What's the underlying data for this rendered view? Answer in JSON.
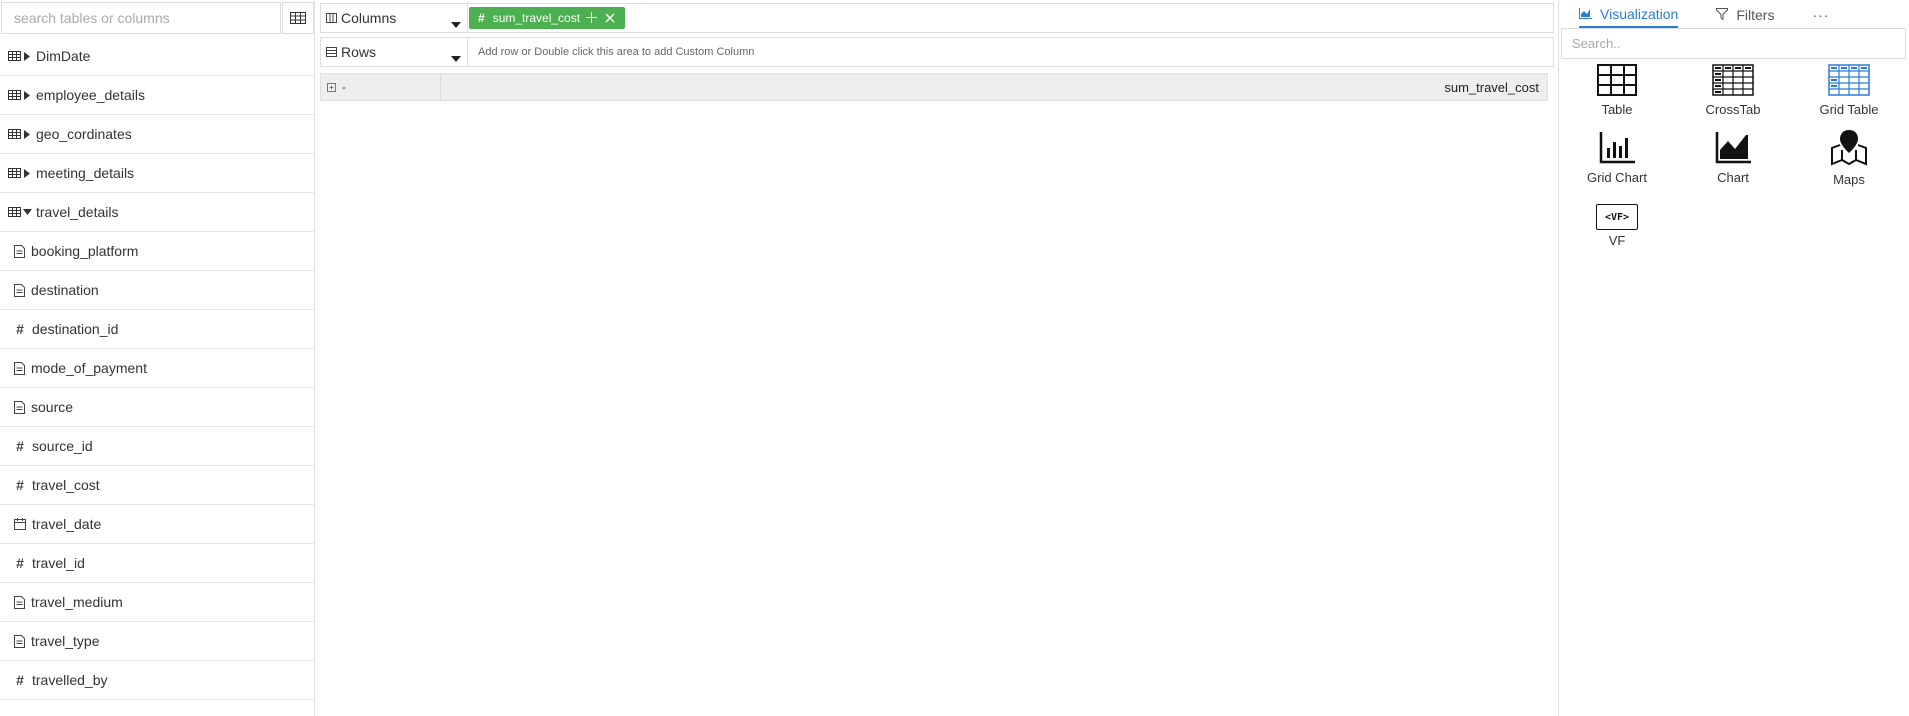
{
  "left_panel": {
    "search_placeholder": "search tables or columns",
    "tables": [
      {
        "label": "DimDate",
        "expanded": false
      },
      {
        "label": "employee_details",
        "expanded": false
      },
      {
        "label": "geo_cordinates",
        "expanded": false
      },
      {
        "label": "meeting_details",
        "expanded": false
      },
      {
        "label": "travel_details",
        "expanded": true
      }
    ],
    "columns": [
      {
        "label": "booking_platform",
        "type": "text"
      },
      {
        "label": "destination",
        "type": "text"
      },
      {
        "label": "destination_id",
        "type": "number"
      },
      {
        "label": "mode_of_payment",
        "type": "text"
      },
      {
        "label": "source",
        "type": "text"
      },
      {
        "label": "source_id",
        "type": "number"
      },
      {
        "label": "travel_cost",
        "type": "number"
      },
      {
        "label": "travel_date",
        "type": "date"
      },
      {
        "label": "travel_id",
        "type": "number"
      },
      {
        "label": "travel_medium",
        "type": "text"
      },
      {
        "label": "travel_type",
        "type": "text"
      },
      {
        "label": "travelled_by",
        "type": "number"
      }
    ]
  },
  "builder": {
    "columns_label": "Columns",
    "rows_label": "Rows",
    "column_pill": {
      "hash": "#",
      "label": "sum_travel_cost",
      "color": "#4caf50"
    },
    "rows_hint": "Add row or Double click this area to add Custom Column",
    "grid": {
      "first_header": "-",
      "column_header": "sum_travel_cost"
    }
  },
  "right_panel": {
    "tabs": [
      {
        "label": "Visualization",
        "active": true,
        "icon": "chart-area-icon"
      },
      {
        "label": "Filters",
        "active": false,
        "icon": "filter-icon"
      }
    ],
    "more": "···",
    "search_placeholder": "Search..",
    "visualizations": [
      {
        "label": "Table",
        "icon": "table-icon"
      },
      {
        "label": "CrossTab",
        "icon": "crosstab-icon"
      },
      {
        "label": "Grid Table",
        "icon": "grid-table-icon"
      },
      {
        "label": "Grid Chart",
        "icon": "grid-chart-icon"
      },
      {
        "label": "Chart",
        "icon": "area-chart-icon"
      },
      {
        "label": "Maps",
        "icon": "map-icon"
      },
      {
        "label": "VF",
        "icon": "vf-icon",
        "badge": "<VF>"
      }
    ],
    "accent_color": "#2b7bd8"
  }
}
